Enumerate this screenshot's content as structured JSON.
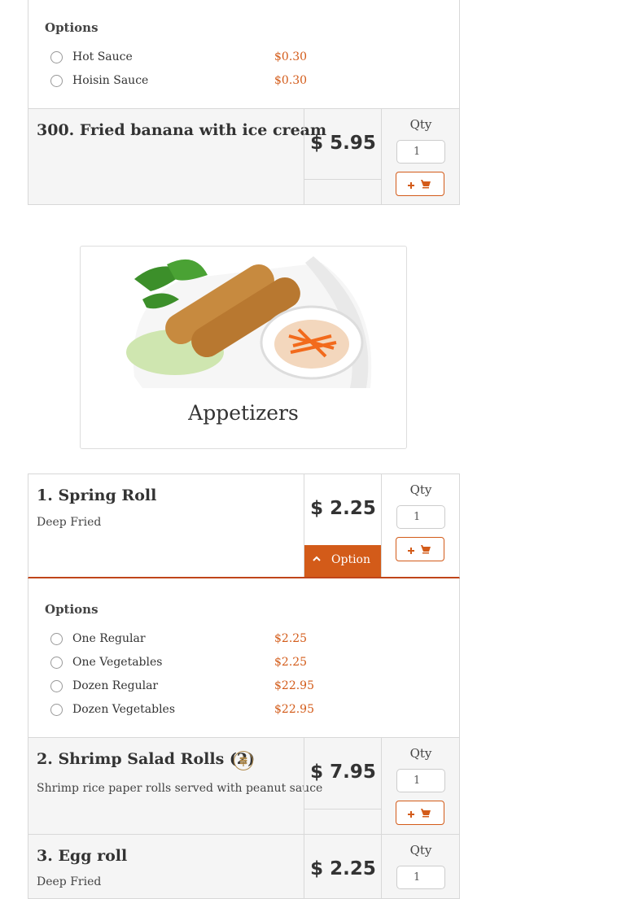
{
  "top_options": {
    "title": "Options",
    "items": [
      {
        "name": "Hot Sauce",
        "price": "$0.30"
      },
      {
        "name": "Hoisin Sauce",
        "price": "$0.30"
      }
    ]
  },
  "item300": {
    "name": "300. Fried banana with ice cream",
    "price": "$ 5.95",
    "qty_label": "Qty",
    "qty_value": "1"
  },
  "category": {
    "name": "Appetizers",
    "image_icon": "spring-roll-photo"
  },
  "item1": {
    "name": "1. Spring Roll",
    "desc": "Deep Fried",
    "price": "$ 2.25",
    "option_label": "Option",
    "qty_label": "Qty",
    "qty_value": "1"
  },
  "item1_options": {
    "title": "Options",
    "items": [
      {
        "name": "One Regular",
        "price": "$2.25"
      },
      {
        "name": "One Vegetables",
        "price": "$2.25"
      },
      {
        "name": "Dozen Regular",
        "price": "$22.95"
      },
      {
        "name": "Dozen Vegetables",
        "price": "$22.95"
      }
    ]
  },
  "item2": {
    "name": "2. Shrimp Salad Rolls (2)",
    "badge_icon": "gluten-icon",
    "desc": "Shrimp rice paper rolls served with peanut sauce",
    "price": "$ 7.95",
    "qty_label": "Qty",
    "qty_value": "1"
  },
  "item3": {
    "name": "3. Egg roll",
    "desc": "Deep Fried",
    "price": "$ 2.25",
    "qty_label": "Qty",
    "qty_value": "1"
  },
  "colors": {
    "accent": "#d35b19",
    "row_bg": "#f5f5f5",
    "border": "#d8d8d8"
  }
}
